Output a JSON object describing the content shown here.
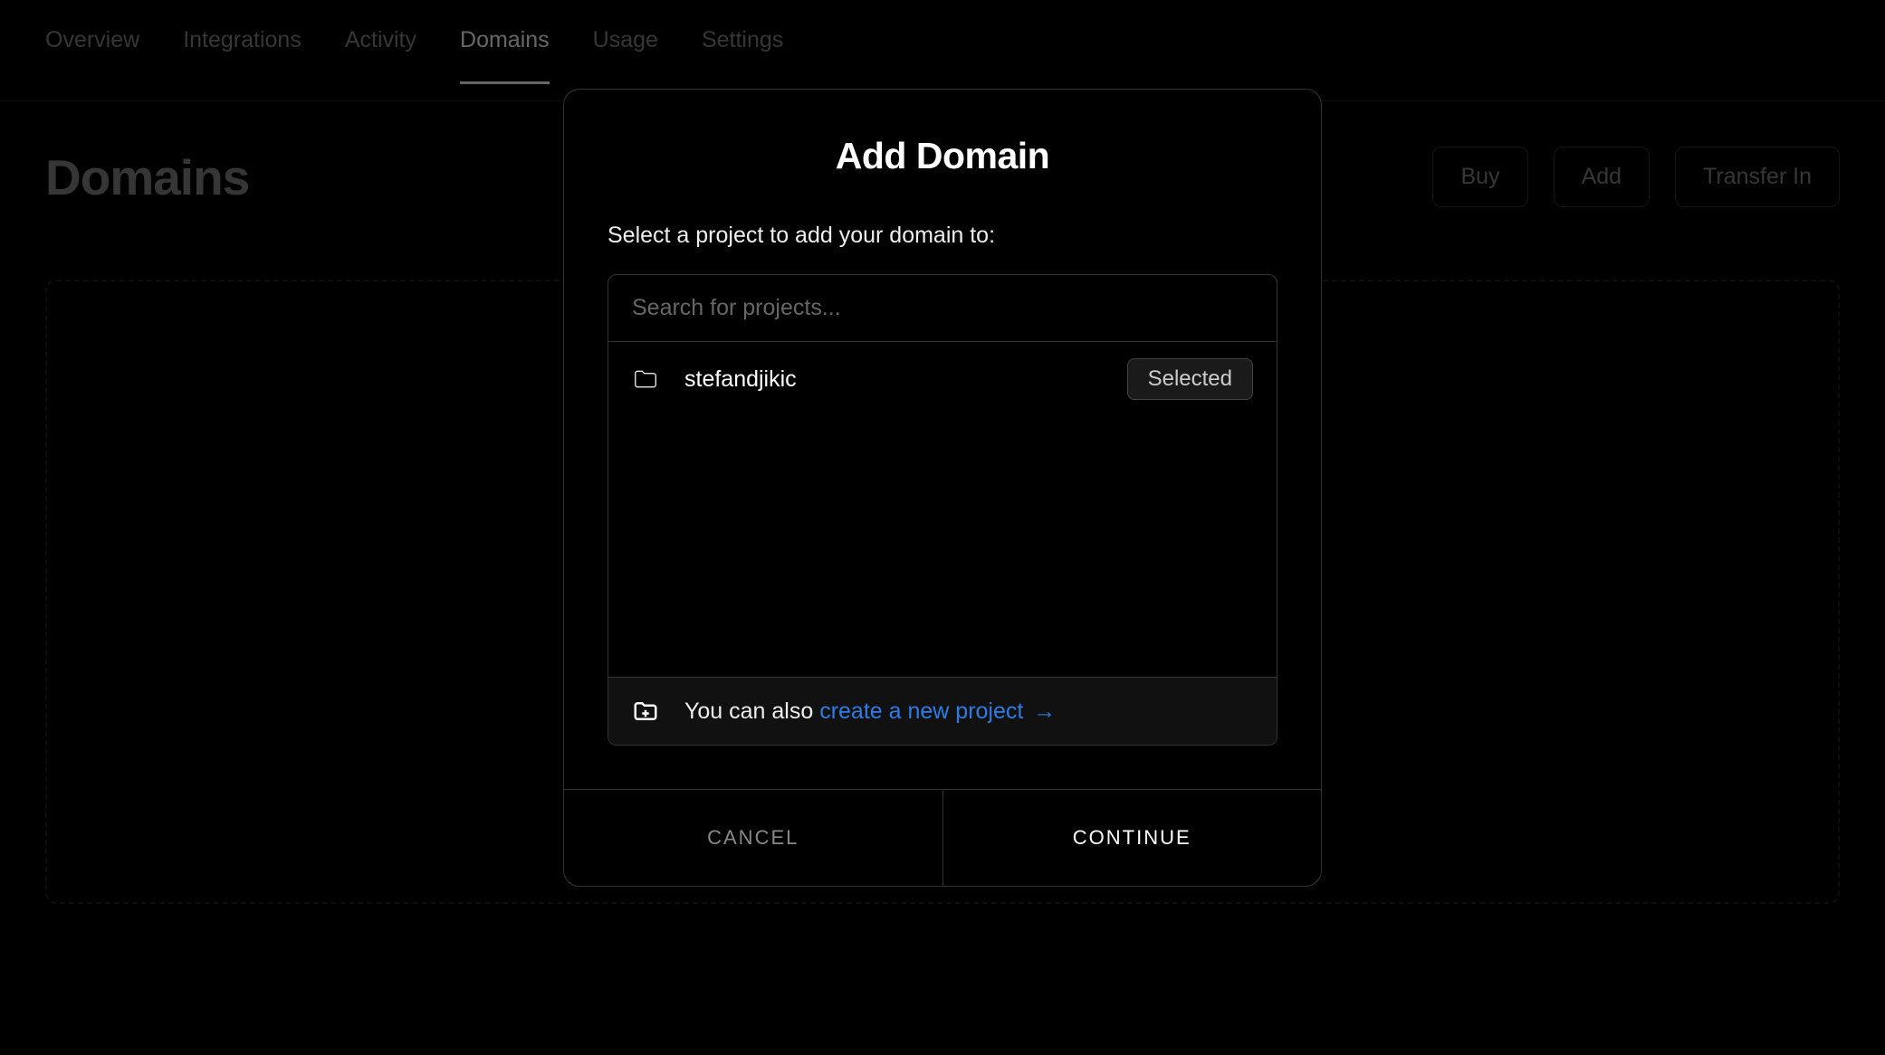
{
  "tabs": [
    {
      "label": "Overview",
      "active": false
    },
    {
      "label": "Integrations",
      "active": false
    },
    {
      "label": "Activity",
      "active": false
    },
    {
      "label": "Domains",
      "active": true
    },
    {
      "label": "Usage",
      "active": false
    },
    {
      "label": "Settings",
      "active": false
    }
  ],
  "page": {
    "title": "Domains"
  },
  "actions": {
    "buy": "Buy",
    "add": "Add",
    "transfer_in": "Transfer In"
  },
  "modal": {
    "title": "Add Domain",
    "prompt": "Select a project to add your domain to:",
    "search_placeholder": "Search for projects...",
    "projects": [
      {
        "name": "stefandjikic",
        "selected": true
      }
    ],
    "selected_label": "Selected",
    "new_project_prefix": "You can also ",
    "new_project_link": "create a new project",
    "cancel_label": "CANCEL",
    "continue_label": "CONTINUE"
  }
}
